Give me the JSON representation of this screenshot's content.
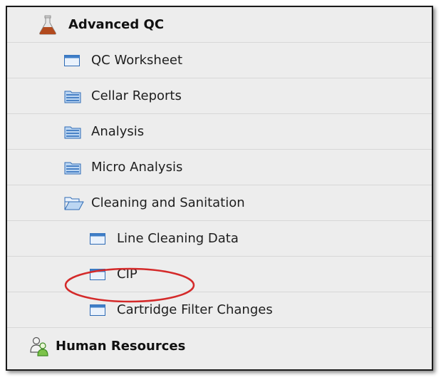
{
  "colors": {
    "frame_background": "#ededed",
    "frame_border": "#1a1a1a",
    "row_divider": "#d7d7d7",
    "folder_icon": "#4a82c6",
    "window_icon": "#3f7ec7",
    "flask_liquid": "#b24a1e",
    "highlight_ellipse": "#d42a2a"
  },
  "menu": {
    "sections": [
      {
        "label": "Advanced QC",
        "icon": "flask-icon"
      },
      {
        "label": "Human Resources",
        "icon": "users-icon"
      }
    ],
    "items": [
      {
        "label": "QC Worksheet",
        "icon": "window-icon",
        "level": 1
      },
      {
        "label": "Cellar Reports",
        "icon": "folder-icon",
        "level": 1
      },
      {
        "label": "Analysis",
        "icon": "folder-icon",
        "level": 1
      },
      {
        "label": "Micro Analysis",
        "icon": "folder-icon",
        "level": 1
      },
      {
        "label": "Cleaning and Sanitation",
        "icon": "folder-open-icon",
        "level": 1,
        "expanded": true
      },
      {
        "label": "Line Cleaning Data",
        "icon": "window-icon",
        "level": 2
      },
      {
        "label": "CIP",
        "icon": "window-icon",
        "level": 2,
        "highlighted": true
      },
      {
        "label": "Cartridge Filter Changes",
        "icon": "window-icon",
        "level": 2
      }
    ]
  }
}
